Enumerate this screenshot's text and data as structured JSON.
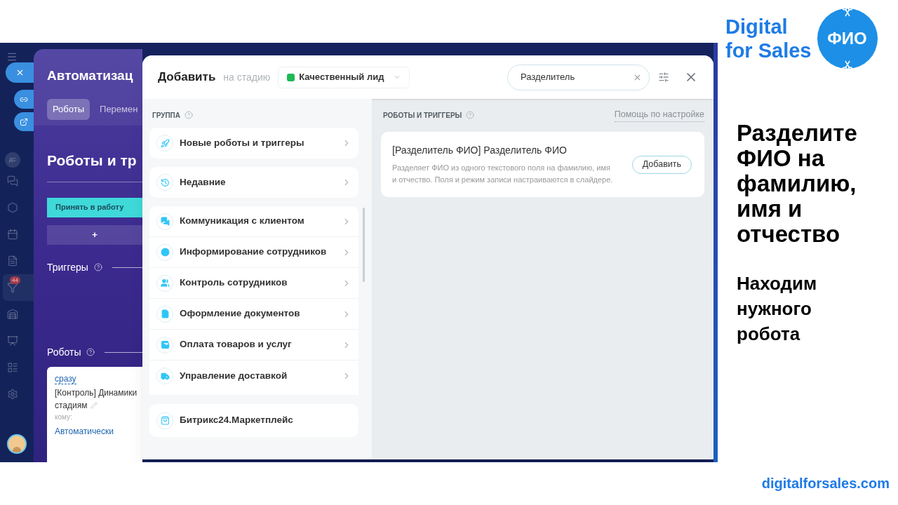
{
  "sidebar": {
    "initials": "ДС",
    "badge": "44"
  },
  "panel": {
    "title": "Автоматизац",
    "tabs": [
      {
        "label": "Роботы",
        "selected": true
      },
      {
        "label": "Перемен",
        "selected": false
      }
    ],
    "heading": "Роботы и тр",
    "stage_button": "Принять в работу",
    "add_button": "+",
    "triggers_label": "Триггеры",
    "robots_label": "Роботы",
    "robot_card": {
      "timing": "сразу",
      "title_line_1": "[Контроль] Динамики",
      "title_line_2": "стадиям",
      "to_label": "кому:",
      "to_value": "Автоматически"
    }
  },
  "modal": {
    "title": "Добавить",
    "stage_prefix": "на стадию",
    "stage": {
      "label": "Качественный лид",
      "color": "#1db954"
    },
    "search": {
      "value": "Разделитель"
    },
    "groups_label": "ГРУППА",
    "group_sections": [
      {
        "items": [
          "Новые роботы и триггеры"
        ]
      },
      {
        "items": [
          "Недавние"
        ]
      },
      {
        "items": [
          "Коммуникация с клиентом",
          "Информирование сотрудников",
          "Контроль сотрудников",
          "Оформление документов",
          "Оплата товаров и услуг",
          "Управление доставкой"
        ]
      }
    ],
    "marketplace": "Битрикс24.Маркетплейс",
    "results_label": "РОБОТЫ И ТРИГГЕРЫ",
    "help_link": "Помощь по настройке",
    "results": [
      {
        "title": "[Разделитель ФИО] Разделитель ФИО",
        "description": "Разделяет ФИО из одного текстового поля на фамилию, имя и отчество. Поля и режим записи настраиваются в слайдере.",
        "button": "Добавить"
      }
    ]
  },
  "slide": {
    "logo_line_1": "Digital",
    "logo_line_2": "for Sales",
    "logo_badge": "ФИО",
    "headline": "Разделите ФИО на фамилию, имя и отчество",
    "subheading": "Находим нужного робота",
    "url": "digitalforsales.com"
  }
}
